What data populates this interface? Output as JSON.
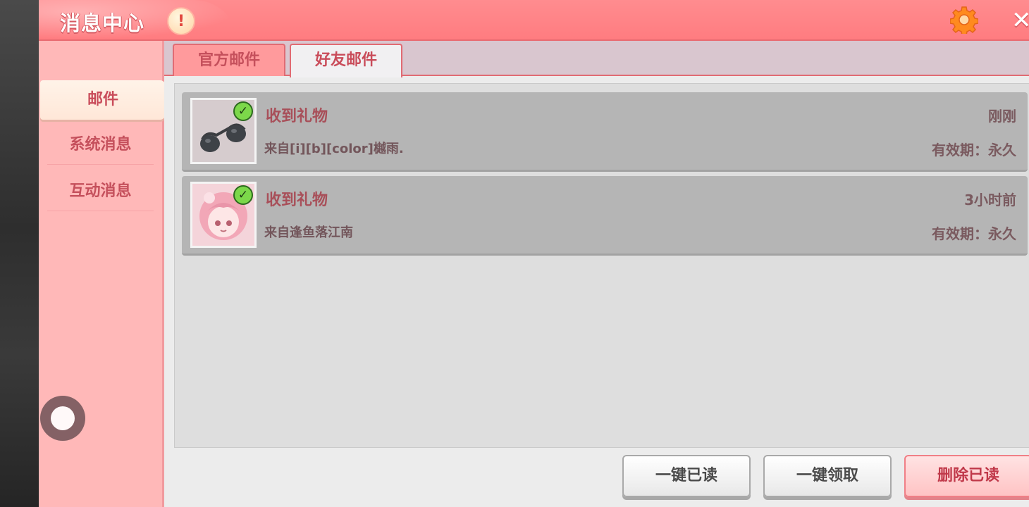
{
  "header": {
    "title": "消息中心",
    "alert_symbol": "!"
  },
  "sidebar": {
    "items": [
      {
        "label": "邮件",
        "active": true
      },
      {
        "label": "系统消息",
        "active": false
      },
      {
        "label": "互动消息",
        "active": false
      }
    ]
  },
  "tabs": [
    {
      "label": "官方邮件",
      "active": false
    },
    {
      "label": "好友邮件",
      "active": true
    }
  ],
  "mails": [
    {
      "title": "收到礼物",
      "from": "来自[i][b][color]樾雨.",
      "time": "刚刚",
      "validity": "有效期：永久",
      "thumb_icon": "sunglasses-icon"
    },
    {
      "title": "收到礼物",
      "from": "来自逢鱼落江南",
      "time": "3小时前",
      "validity": "有效期：永久",
      "thumb_icon": "avatar-girl-icon"
    }
  ],
  "buttons": {
    "mark_all_read": "一键已读",
    "claim_all": "一键领取",
    "delete_read": "删除已读"
  },
  "colors": {
    "header": "#ff7c80",
    "sidebar": "#ffb8b8",
    "accent_text": "#c5505c",
    "mail_bg": "#b5b5b5"
  }
}
